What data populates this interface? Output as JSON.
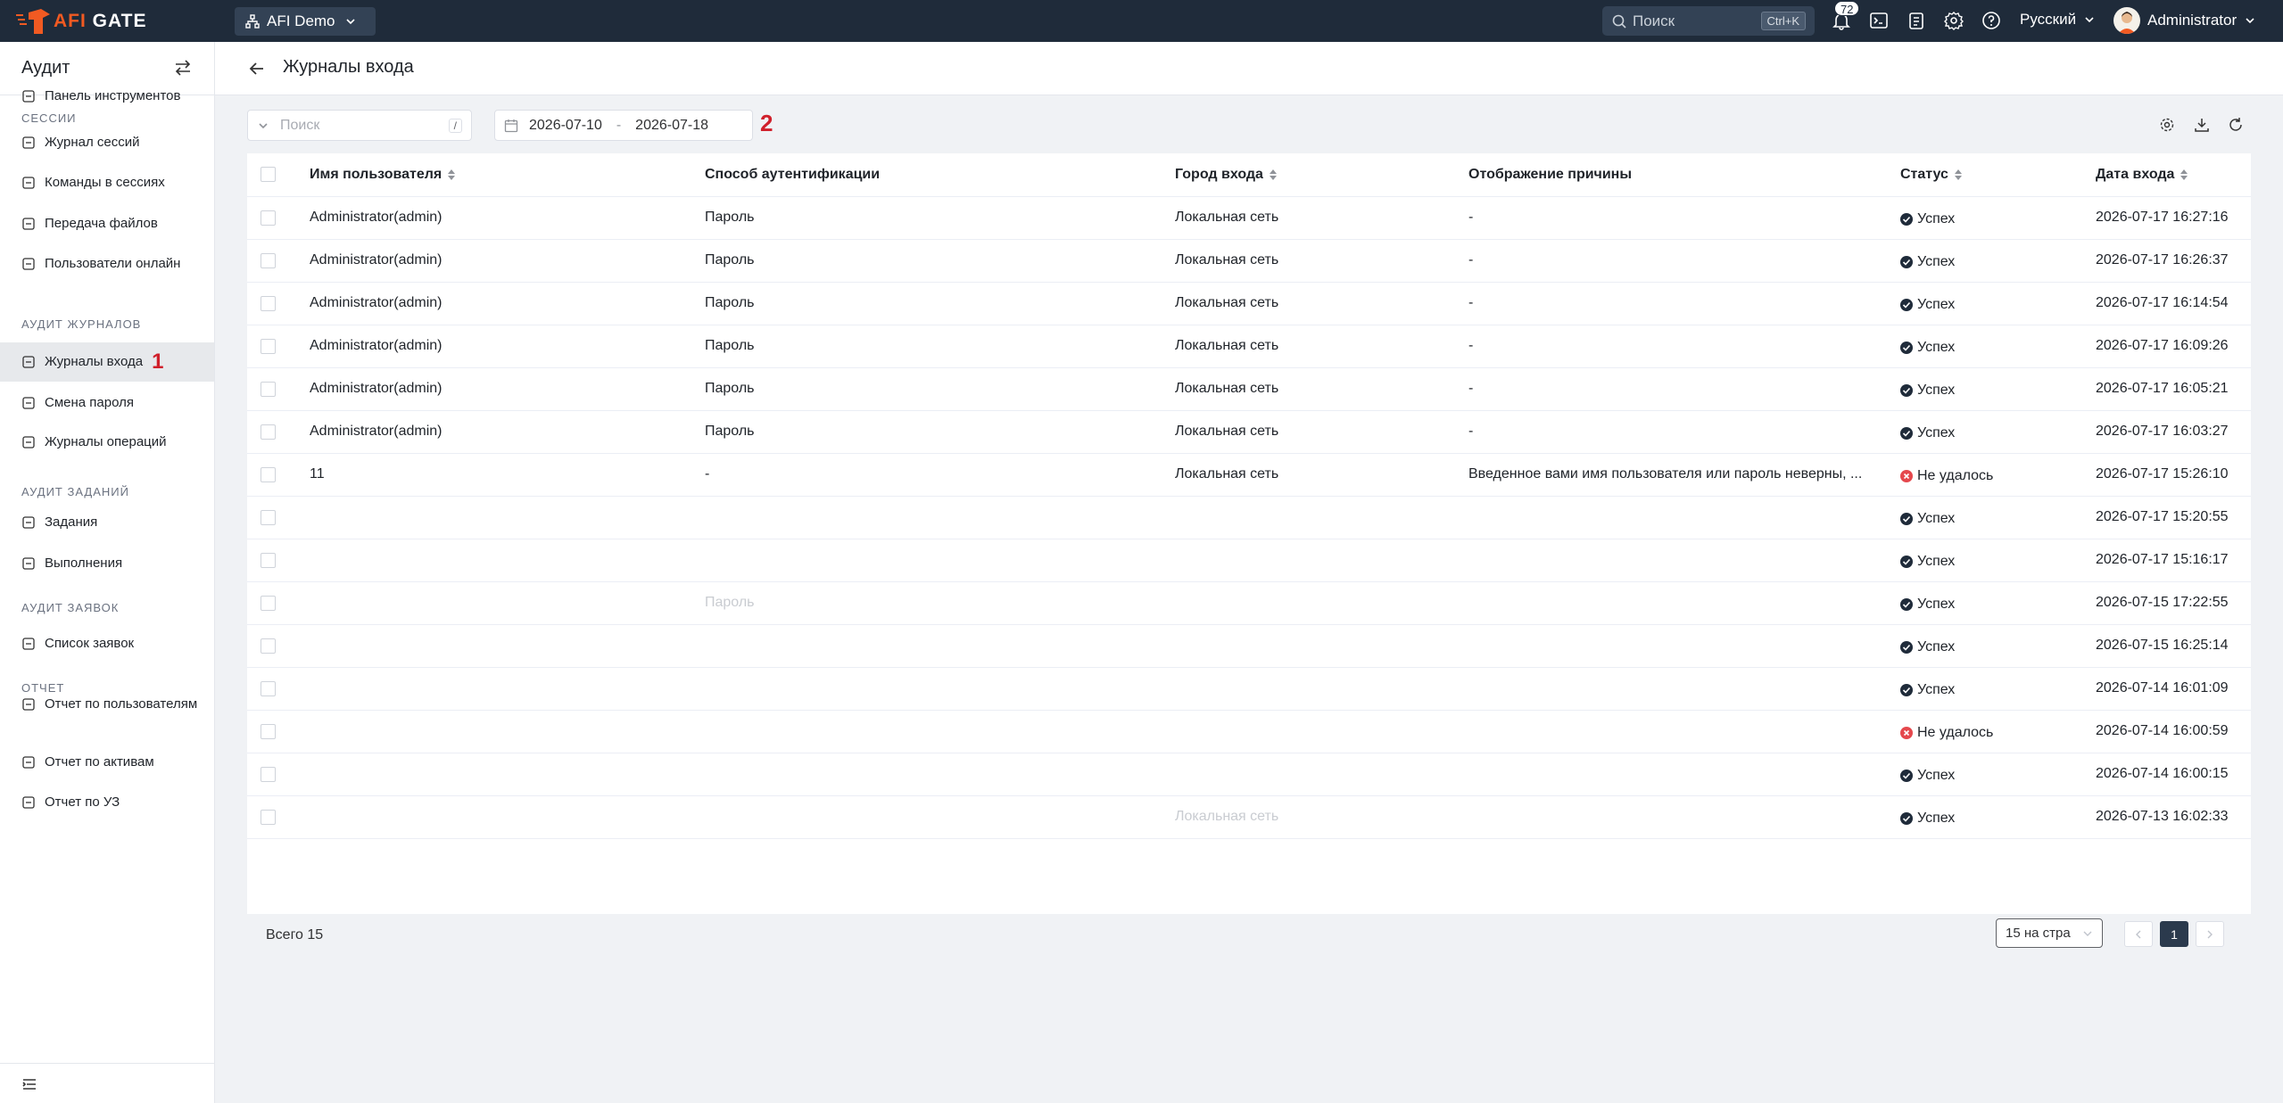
{
  "topbar": {
    "logo_text_afi": "AFI",
    "logo_text_gate": "GATE",
    "org_select": "AFI Demo",
    "search_placeholder": "Поиск",
    "search_shortcut": "Ctrl+K",
    "notification_count": "72",
    "language": "Русский",
    "user_name": "Administrator"
  },
  "sidebar": {
    "title": "Аудит",
    "items": [
      {
        "label": "Панель инструментов",
        "icon": "dashboard-icon"
      },
      {
        "group": "СЕССИИ"
      },
      {
        "label": "Журнал сессий",
        "icon": "link-icon"
      },
      {
        "label": "Команды в сессиях",
        "icon": "terminal-icon"
      },
      {
        "label": "Передача файлов",
        "icon": "file-transfer-icon"
      },
      {
        "label": "Пользователи онлайн",
        "icon": "online-users-icon"
      },
      {
        "group": "АУДИТ ЖУРНАЛОВ"
      },
      {
        "label": "Журналы входа",
        "icon": "login-log-icon",
        "active": true,
        "marker": "1"
      },
      {
        "label": "Смена пароля",
        "icon": "lock-icon"
      },
      {
        "label": "Журналы операций",
        "icon": "operations-log-icon"
      },
      {
        "group": "АУДИТ ЗАДАНИЙ"
      },
      {
        "label": "Задания",
        "icon": "task-icon"
      },
      {
        "label": "Выполнения",
        "icon": "history-icon"
      },
      {
        "group": "АУДИТ ЗАЯВОК"
      },
      {
        "label": "Список заявок",
        "icon": "ticket-icon"
      },
      {
        "group": "ОТЧЕТ"
      },
      {
        "label": "Отчет по пользователям",
        "icon": "user-icon"
      },
      {
        "label": "Отчет по активам",
        "icon": "monitor-icon"
      },
      {
        "label": "Отчет по УЗ",
        "icon": "lock-icon"
      }
    ]
  },
  "page": {
    "title": "Журналы входа"
  },
  "filters": {
    "search_placeholder": "Поиск",
    "search_shortcut": "/",
    "date_from": "2026-07-10",
    "date_sep": "-",
    "date_to": "2026-07-18",
    "marker": "2"
  },
  "table": {
    "columns": [
      "Имя пользователя",
      "Способ аутентификации",
      "Город входа",
      "Отображение причины",
      "Статус",
      "Дата входа"
    ],
    "rows": [
      {
        "user": "Administrator(admin)",
        "auth": "Пароль",
        "city": "Локальная сеть",
        "reason": "-",
        "status": "Успех",
        "ok": true,
        "date": "2026-07-17 16:27:16"
      },
      {
        "user": "Administrator(admin)",
        "auth": "Пароль",
        "city": "Локальная сеть",
        "reason": "-",
        "status": "Успех",
        "ok": true,
        "date": "2026-07-17 16:26:37"
      },
      {
        "user": "Administrator(admin)",
        "auth": "Пароль",
        "city": "Локальная сеть",
        "reason": "-",
        "status": "Успех",
        "ok": true,
        "date": "2026-07-17 16:14:54"
      },
      {
        "user": "Administrator(admin)",
        "auth": "Пароль",
        "city": "Локальная сеть",
        "reason": "-",
        "status": "Успех",
        "ok": true,
        "date": "2026-07-17 16:09:26"
      },
      {
        "user": "Administrator(admin)",
        "auth": "Пароль",
        "city": "Локальная сеть",
        "reason": "-",
        "status": "Успех",
        "ok": true,
        "date": "2026-07-17 16:05:21"
      },
      {
        "user": "Administrator(admin)",
        "auth": "Пароль",
        "city": "Локальная сеть",
        "reason": "-",
        "status": "Успех",
        "ok": true,
        "date": "2026-07-17 16:03:27"
      },
      {
        "user": "11",
        "auth": "-",
        "city": "Локальная сеть",
        "reason": "Введенное вами имя пользователя или пароль неверны, ...",
        "status": "Не удалось",
        "ok": false,
        "date": "2026-07-17 15:26:10"
      },
      {
        "user": "",
        "auth": "",
        "city": "",
        "reason": "",
        "status": "Успех",
        "ok": true,
        "date": "2026-07-17 15:20:55"
      },
      {
        "user": "",
        "auth": "",
        "city": "",
        "reason": "",
        "status": "Успех",
        "ok": true,
        "date": "2026-07-17 15:16:17"
      },
      {
        "user": "",
        "auth": "Пароль",
        "city": "",
        "reason": "",
        "status": "Успех",
        "ok": true,
        "date": "2026-07-15 17:22:55"
      },
      {
        "user": "",
        "auth": "",
        "city": "",
        "reason": "",
        "status": "Успех",
        "ok": true,
        "date": "2026-07-15 16:25:14"
      },
      {
        "user": "",
        "auth": "",
        "city": "",
        "reason": "",
        "status": "Успех",
        "ok": true,
        "date": "2026-07-14 16:01:09"
      },
      {
        "user": "",
        "auth": "",
        "city": "",
        "reason": "",
        "status": "Не удалось",
        "ok": false,
        "date": "2026-07-14 16:00:59"
      },
      {
        "user": "",
        "auth": "",
        "city": "",
        "reason": "",
        "status": "Успех",
        "ok": true,
        "date": "2026-07-14 16:00:15"
      },
      {
        "user": "",
        "auth": "",
        "city": "Локальная сеть",
        "reason": "",
        "status": "Успех",
        "ok": true,
        "date": "2026-07-13 16:02:33"
      }
    ]
  },
  "pagination": {
    "total": "Всего 15",
    "page_size": "15 на стра",
    "current_page": "1"
  },
  "colors": {
    "topbar_bg": "#1f2b3a",
    "brand_orange": "#f15a22",
    "marker_red": "#d0202b",
    "fail_red": "#e5484d"
  }
}
